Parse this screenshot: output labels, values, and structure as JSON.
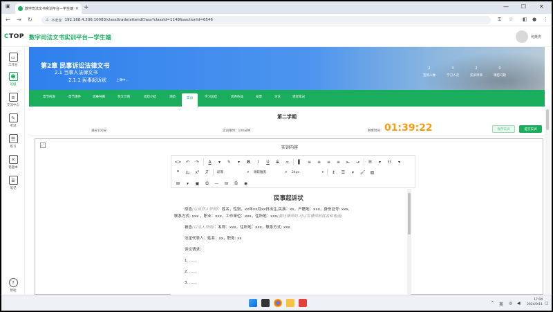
{
  "browser": {
    "tab_title": "数字司法文书实训平台—学生端",
    "security_label": "不安全",
    "url": "192.168.4.206:10083/classGrade/attendClass?classId=1148&sectionId=6546"
  },
  "app": {
    "logo_prefix": "C",
    "logo_rest": "TOP",
    "title": "数字司法文书实训平台—学生端",
    "username": "何英杰"
  },
  "sidebar": {
    "items": [
      {
        "label": "工作台",
        "icon": "desktop-icon"
      },
      {
        "label": "班级",
        "icon": "people-icon"
      },
      {
        "label": "交流中心",
        "icon": "chat-icon"
      },
      {
        "label": "考试",
        "icon": "exam-icon"
      },
      {
        "label": "练习",
        "icon": "practice-icon"
      },
      {
        "label": "错题本",
        "icon": "wrong-book-icon"
      },
      {
        "label": "笔记",
        "icon": "note-icon"
      }
    ],
    "help_label": "帮助"
  },
  "banner": {
    "chapter": "第2章  民事诉讼法律文书",
    "section": "2.1  当事人法律文书",
    "subsection": "2.1.1  民事起诉状",
    "subsection_tag": "上课中...",
    "stats": [
      {
        "value": "2",
        "label": "签到人数"
      },
      {
        "value": "3",
        "label": "学习人次"
      },
      {
        "value": "2",
        "label": "实训项目"
      },
      {
        "value": "0",
        "label": "课后习题"
      }
    ]
  },
  "tabs": [
    "章节内容",
    "章节课件",
    "思维导图",
    "范文示例",
    "思政小结",
    "测验",
    "实训",
    "学习总结",
    "优秀作品",
    "投票",
    "讨论",
    "课堂笔记"
  ],
  "active_tab": "实训",
  "info": {
    "term": "第二学期",
    "full_score": "满分100分",
    "time_limit": "实训限时：100分钟",
    "countdown_label": "剩余时间：",
    "countdown_value": "01:39:22",
    "save_label": "保存实训",
    "submit_label": "提交实训"
  },
  "panel": {
    "title": "实训内容"
  },
  "editor": {
    "paragraph_format": "段落",
    "font_family": "微软雅黑",
    "font_size": "24px"
  },
  "document": {
    "title": "民事起诉状",
    "plaintiff_prefix": "原告",
    "plaintiff_hint": "(以自然人举例)",
    "plaintiff_text": "：姓名，性别，xx年xx月xx日出生,民族：xx，户籍地：xxx，身份证号: xxx,",
    "plaintiff_text2": "联系方式: xxx ，职业：xxx，工作单位：xxx，住所地：xxx",
    "plaintiff_hint2": "(委托律师的,可以写律师的姓名和电话)",
    "defendant_prefix": "被告",
    "defendant_hint": "(以法人举例)",
    "defendant_text": "：名称：xxx，住所地：xxx，联系方式: xxx",
    "legal_rep": "法定代表人：姓名：xx，职务: xx",
    "claims_heading": "诉讼请求：",
    "claims": [
      "1. ......",
      "2. ......",
      "3. ......"
    ]
  },
  "taskbar": {
    "ime": "英",
    "time": "17:04",
    "date": "2024/9/11"
  },
  "colors": {
    "accent": "#1aad5e",
    "countdown": "#f39c12",
    "banner": "#2f80ed"
  }
}
